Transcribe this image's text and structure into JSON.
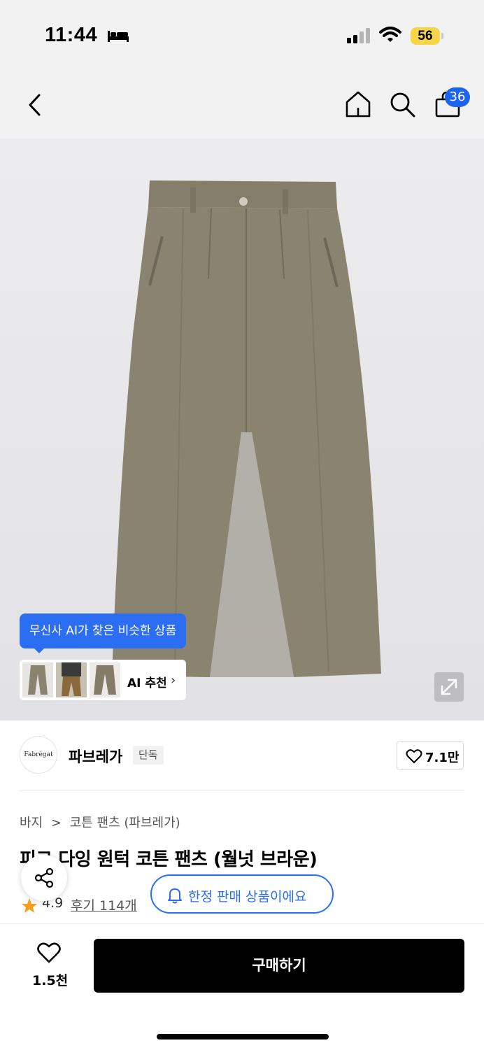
{
  "status_bar": {
    "time": "11:44",
    "battery": "56",
    "icons": [
      "bed-icon",
      "signal-icon",
      "wifi-icon",
      "battery-icon"
    ]
  },
  "nav": {
    "icons": [
      "back-icon",
      "home-icon",
      "search-icon",
      "cart-icon"
    ],
    "cart_count": "36"
  },
  "hero": {
    "ai_bubble": "무신사 AI가 찾은 비슷한 상품",
    "ai_recommend_label": "AI 추천",
    "expand_icon": "expand-icon"
  },
  "brand": {
    "logo_text": "Fabrégat",
    "name": "파브레가",
    "tag": "단독",
    "likes": "7.1만"
  },
  "product": {
    "breadcrumb_1": "바지",
    "breadcrumb_sep": ">",
    "breadcrumb_2": "코튼 팬츠 (파브레가)",
    "title": "피그 다잉 원턱 코튼 팬츠 (월넛 브라운)",
    "rating": "4.9",
    "reviews": "후기 114개",
    "limited_label": "한정 판매 상품이에요"
  },
  "bottom_bar": {
    "wish_count": "1.5천",
    "buy_label": "구매하기"
  },
  "colors": {
    "accent_blue": "#2b6ef2",
    "badge_blue": "#1c63f0",
    "battery_yellow": "#f6d54a",
    "star_orange": "#f5a01a",
    "pants_olive": "#8a8370"
  }
}
